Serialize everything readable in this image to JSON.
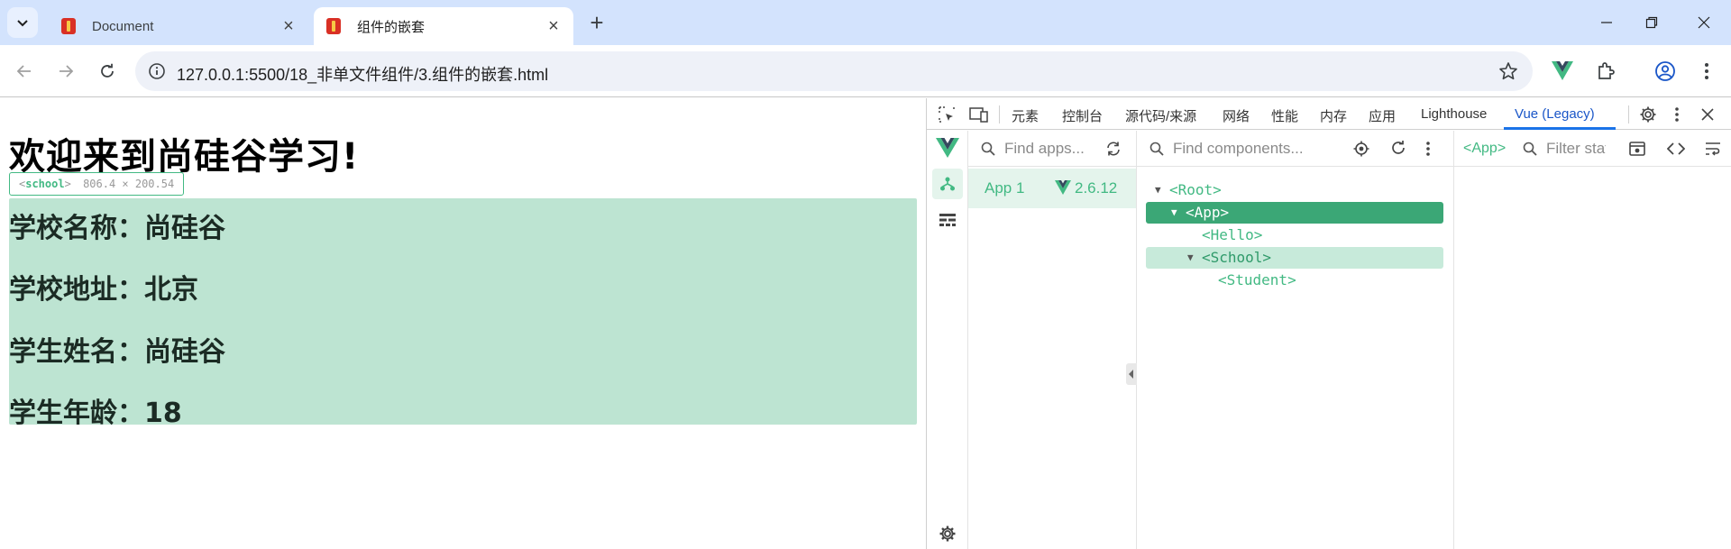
{
  "browser": {
    "tabs": [
      {
        "title": "Document",
        "active": false
      },
      {
        "title": "组件的嵌套",
        "active": true
      }
    ],
    "url": "127.0.0.1:5500/18_非单文件组件/3.组件的嵌套.html"
  },
  "page": {
    "heading": "欢迎来到尚硅谷学习!",
    "inspect_tag": {
      "open": "<",
      "name": "school",
      "close": ">",
      "size": "806.4 × 200.54"
    },
    "school": {
      "name_line": "学校名称：尚硅谷",
      "address_line": "学校地址：北京",
      "student_name_line": "学生姓名：尚硅谷",
      "student_age_line": "学生年龄：18"
    }
  },
  "devtools": {
    "tabs": [
      "元素",
      "控制台",
      "源代码/来源",
      "网络",
      "性能",
      "内存",
      "应用",
      "Lighthouse",
      "Vue (Legacy)"
    ],
    "active_tab": "Vue (Legacy)",
    "vue": {
      "apps_search_placeholder": "Find apps...",
      "apps": [
        {
          "name": "App 1",
          "version": "2.6.12"
        }
      ],
      "components_search_placeholder": "Find components...",
      "tree": [
        {
          "label": "<Root>",
          "depth": 0,
          "caret": "▼",
          "state": "normal"
        },
        {
          "label": "<App>",
          "depth": 1,
          "caret": "▼",
          "state": "selected"
        },
        {
          "label": "<Hello>",
          "depth": 2,
          "caret": "",
          "state": "normal"
        },
        {
          "label": "<School>",
          "depth": 2,
          "caret": "▼",
          "state": "highlight"
        },
        {
          "label": "<Student>",
          "depth": 3,
          "caret": "",
          "state": "normal"
        }
      ],
      "selected_component": "<App>",
      "state_filter_placeholder": "Filter state..."
    }
  },
  "colors": {
    "vue_green": "#42b983",
    "selected_row": "#3ba776",
    "highlight_box": "#bde4d2",
    "active_devtools_tab": "#1a73e8",
    "tabstrip": "#d3e3fd"
  },
  "icons": [
    "search-tabs-icon",
    "favicon-icon",
    "close-icon",
    "new-tab-icon",
    "minimize-icon",
    "restore-icon",
    "window-close-icon",
    "back-icon",
    "forward-icon",
    "reload-icon",
    "site-info-icon",
    "bookmark-star-icon",
    "vue-extension-icon",
    "extensions-puzzle-icon",
    "profile-icon",
    "kebab-menu-icon",
    "inspect-icon",
    "device-toggle-icon",
    "settings-gear-icon",
    "vue-logo-icon",
    "component-tree-icon",
    "timeline-icon",
    "refresh-icon",
    "target-icon",
    "code-icon",
    "wrap-icon"
  ]
}
